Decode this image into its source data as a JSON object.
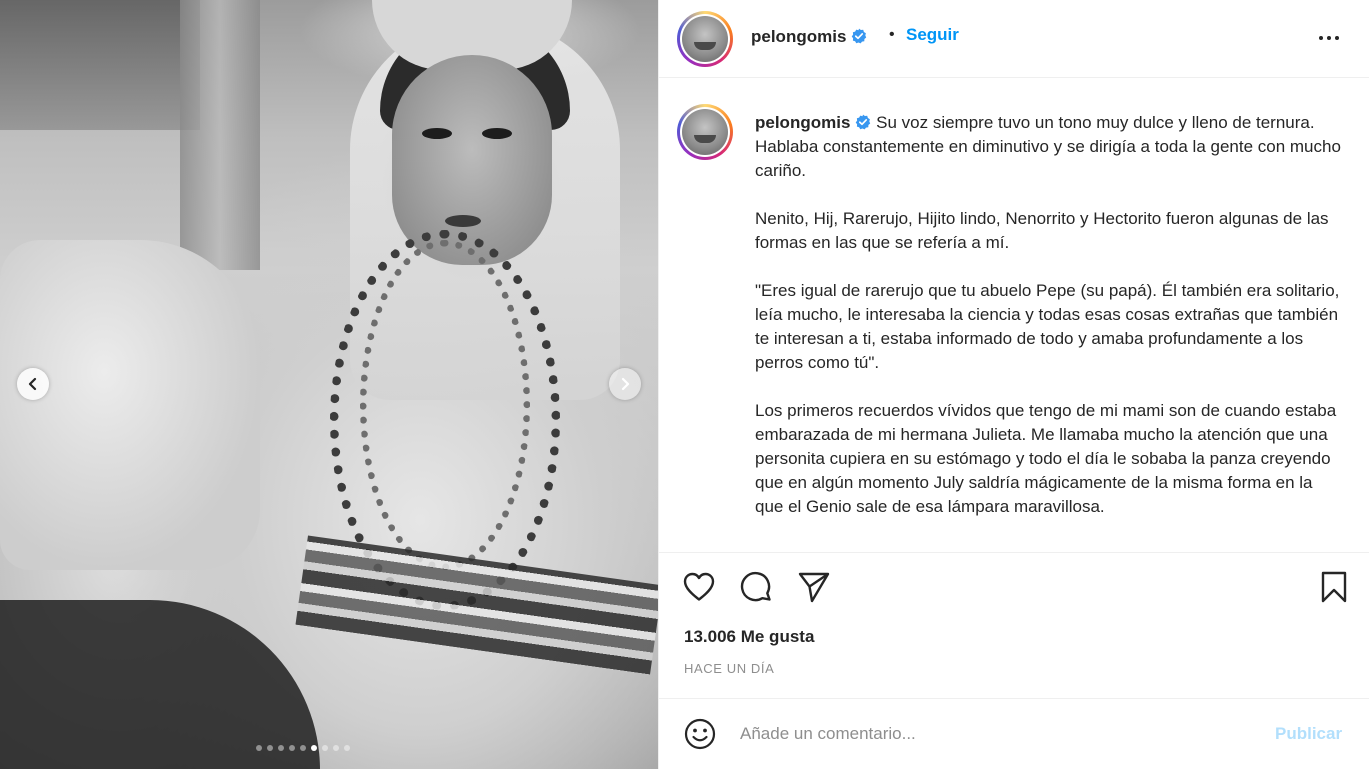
{
  "post": {
    "username": "pelongomis",
    "follow_label": "Seguir",
    "separator": "•",
    "caption": " Su voz siempre tuvo un tono muy dulce y lleno de ternura. Hablaba constantemente en diminutivo y se dirigía a toda la gente con mucho cariño.\n\nNenito, Hij, Rarerujo, Hijito lindo, Nenorrito y Hectorito fueron algunas de las formas en las que se refería a mí.\n\n\"Eres igual de rarerujo que tu abuelo Pepe (su papá). Él también era solitario, leía mucho, le interesaba la ciencia y todas esas cosas extrañas que también te interesan a ti, estaba informado de todo y amaba profundamente a los perros como tú\".\n\nLos primeros recuerdos vívidos que tengo de mi mami son de cuando estaba embarazada de mi hermana Julieta. Me llamaba mucho la atención que una personita cupiera en su estómago y todo el día le sobaba la panza creyendo que en algún momento July saldría mágicamente de la misma forma en la que el Genio sale de esa lámpara maravillosa.",
    "likes": "13.006 Me gusta",
    "timestamp": "HACE UN DÍA"
  },
  "media": {
    "carousel_index": 6,
    "carousel_count": 9,
    "prev_icon": "chevron-left-icon",
    "next_icon": "chevron-right-icon"
  },
  "actions": {
    "like_icon": "heart-icon",
    "comment_icon": "comment-icon",
    "share_icon": "paper-plane-icon",
    "save_icon": "bookmark-icon"
  },
  "comment": {
    "placeholder": "Añade un comentario...",
    "publish_label": "Publicar",
    "emoji_icon": "smiley-icon"
  },
  "colors": {
    "accent": "#0095f6",
    "verified": "#3897f0",
    "publish_disabled": "#b2dffc",
    "muted": "#8e8e8e"
  }
}
